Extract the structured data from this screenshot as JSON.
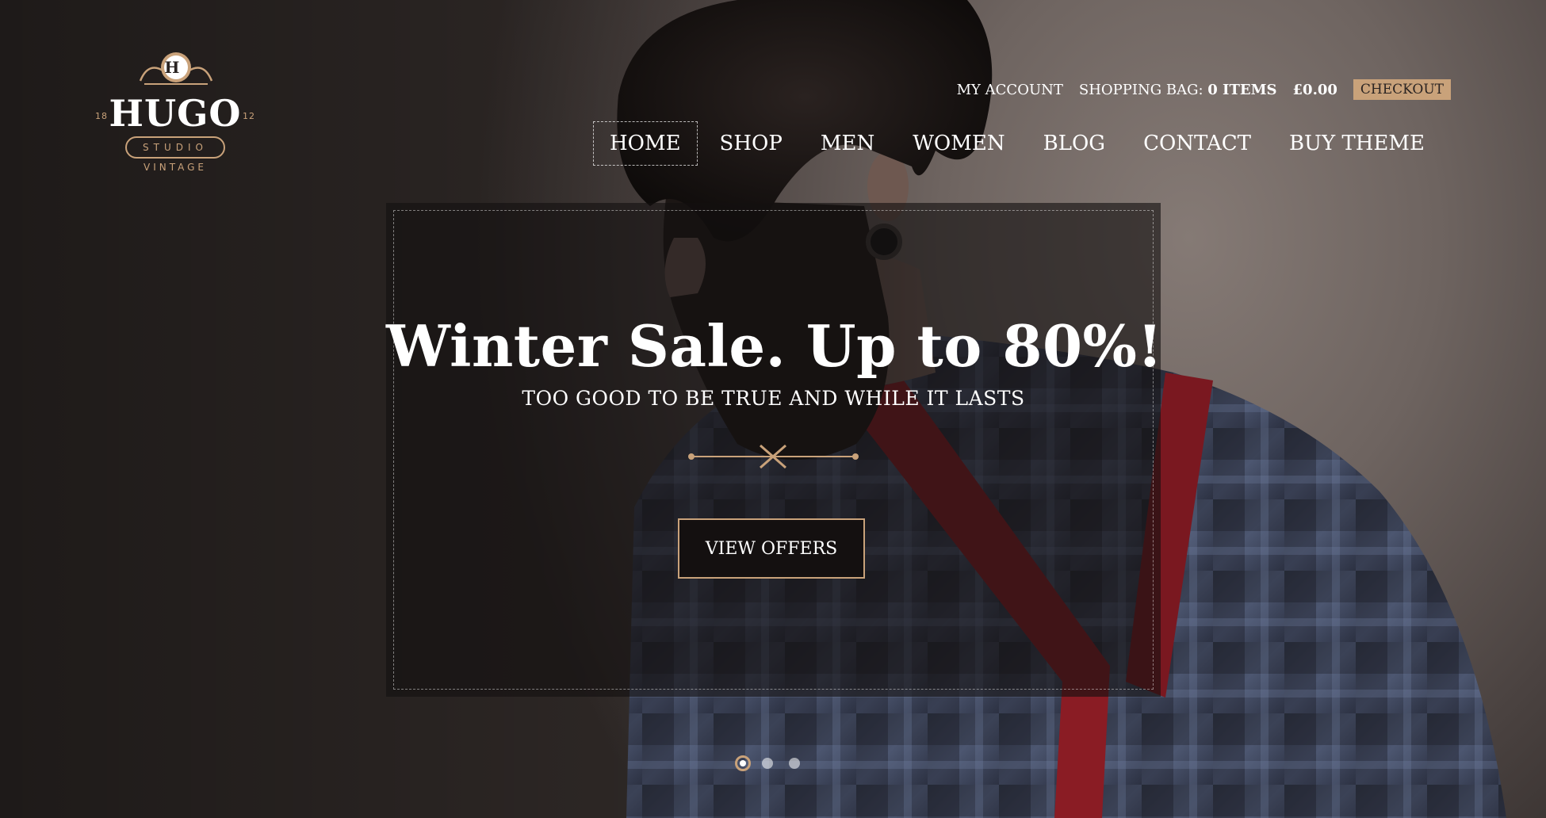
{
  "logo": {
    "name": "HUGO",
    "crest_letter": "H",
    "year_left": "18",
    "year_right": "12",
    "pill": "STUDIO",
    "sub": "VINTAGE"
  },
  "utility": {
    "my_account": "MY ACCOUNT",
    "bag_label": "SHOPPING BAG:",
    "bag_count": "0 ITEMS",
    "total": "£0.00",
    "checkout": "CHECKOUT"
  },
  "nav": {
    "items": [
      {
        "label": "HOME",
        "active": true
      },
      {
        "label": "SHOP"
      },
      {
        "label": "MEN"
      },
      {
        "label": "WOMEN"
      },
      {
        "label": "BLOG"
      },
      {
        "label": "CONTACT"
      },
      {
        "label": "BUY THEME"
      }
    ]
  },
  "slide": {
    "title": "Winter Sale. Up to 80%!",
    "subtitle": "TOO GOOD TO BE TRUE AND WHILE IT LASTS",
    "cta": "VIEW OFFERS"
  },
  "carousel": {
    "slides": 3,
    "current": 1
  },
  "colors": {
    "accent": "#c9a27a",
    "dark": "#141010"
  }
}
